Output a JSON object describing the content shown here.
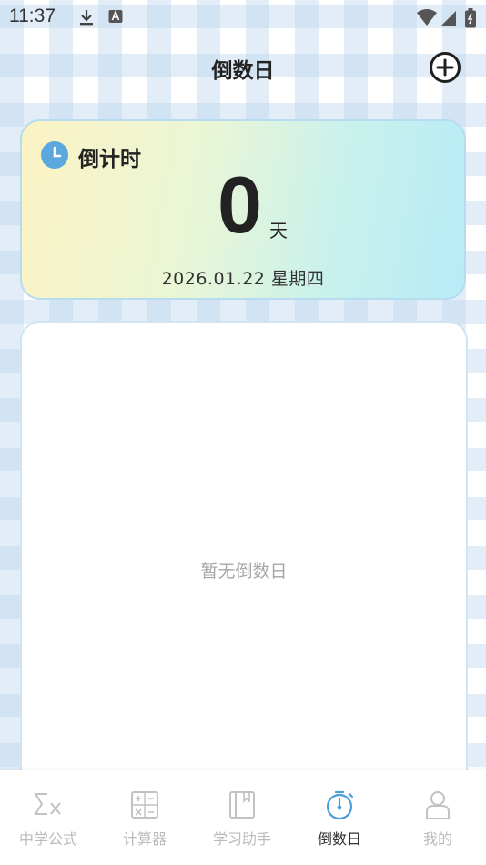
{
  "status_bar": {
    "time": "11:37",
    "icons": [
      "download-icon",
      "keyboard-a-icon",
      "wifi-icon",
      "signal-icon",
      "battery-icon"
    ]
  },
  "header": {
    "title": "倒数日",
    "add_icon": "plus-circle-icon"
  },
  "countdown_card": {
    "label": "倒计时",
    "days": "0",
    "unit": "天",
    "date": "2026.01.22 星期四",
    "icon": "clock-icon"
  },
  "list": {
    "empty_text": "暂无倒数日"
  },
  "bottom_nav": {
    "items": [
      {
        "label": "中学公式",
        "icon": "sigma-x-icon"
      },
      {
        "label": "计算器",
        "icon": "calculator-icon"
      },
      {
        "label": "学习助手",
        "icon": "book-icon"
      },
      {
        "label": "倒数日",
        "icon": "stopwatch-icon",
        "active": true
      },
      {
        "label": "我的",
        "icon": "profile-icon"
      }
    ]
  },
  "colors": {
    "accent": "#4a9fd8",
    "text": "#222222",
    "inactive": "#bbbbbb"
  }
}
